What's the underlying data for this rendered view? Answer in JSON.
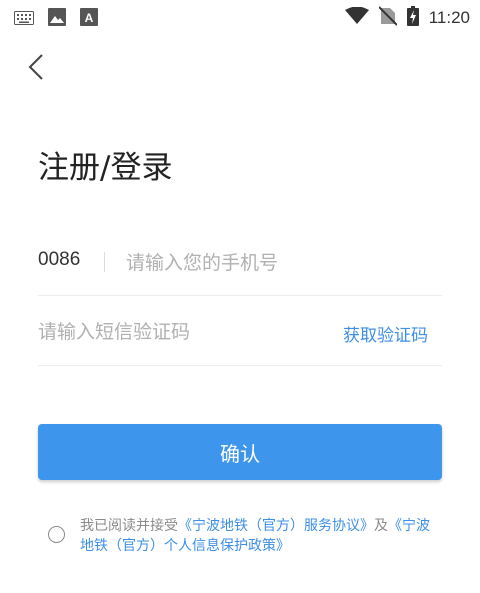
{
  "status_bar": {
    "time": "11:20",
    "left_icons": [
      "keyboard-icon",
      "image-icon",
      "font-a-icon"
    ],
    "right_icons": [
      "wifi-icon",
      "no-sim-icon",
      "battery-charging-icon"
    ]
  },
  "header": {
    "back_icon": "chevron-left-icon"
  },
  "page": {
    "title": "注册/登录"
  },
  "form": {
    "country_code": "0086",
    "phone_placeholder": "请输入您的手机号",
    "code_placeholder": "请输入短信验证码",
    "get_code_label": "获取验证码",
    "confirm_label": "确认"
  },
  "agreement": {
    "prefix": "我已阅读并接受",
    "service_link": "《宁波地铁（官方）服务协议》",
    "conjunction": "及",
    "privacy_link": "《宁波地铁（官方）个人信息保护政策》"
  },
  "colors": {
    "accent": "#3e95ec",
    "link": "#3d8fe6",
    "muted": "#8a8a8a"
  }
}
